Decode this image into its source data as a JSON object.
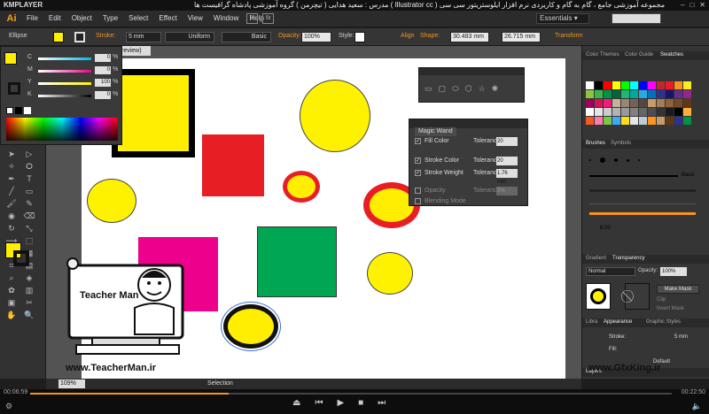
{
  "player": {
    "brand": "KMPLAYER",
    "title": "مجموعه آموزشی جامع ، گام به گام و کاربردی نرم افزار ایلوستریتور سی سی ( Illustrator cc )  مدرس : سعید هدایی ( تیچرمن ) گروه آموزشی پادشاه گرافیست ها",
    "time_elapsed": "00:06:59",
    "time_total": "00:22:50",
    "progress": 0.31
  },
  "app": {
    "logo": "Ai",
    "menus": [
      "File",
      "Edit",
      "Object",
      "Type",
      "Select",
      "Effect",
      "View",
      "Window",
      "Help"
    ],
    "menu_icons": [
      "Br",
      "St"
    ],
    "workspace": "Essentials"
  },
  "control_bar": {
    "object_type": "Ellipse",
    "fill_color": "#ffee00",
    "stroke_label": "Stroke:",
    "stroke_width": "5 mm",
    "profile": "Uniform",
    "brush": "Basic",
    "opacity_label": "Opacity:",
    "opacity_value": "100%",
    "style_label": "Style:",
    "align_label": "Align",
    "shape_label": "Shape:",
    "shape_width": "30.483 mm",
    "shape_height": "26.715 mm",
    "transform_label": "Transform"
  },
  "document": {
    "tab_label": "review)"
  },
  "color_panel": {
    "rows": [
      {
        "label": "C",
        "value": "0",
        "unit": "%",
        "color": "#00b4f0"
      },
      {
        "label": "M",
        "value": "0",
        "unit": "%",
        "color": "#ec008c"
      },
      {
        "label": "Y",
        "value": "100",
        "unit": "%",
        "color": "#fff200"
      },
      {
        "label": "K",
        "value": "0",
        "unit": "%",
        "color": "#000000"
      }
    ]
  },
  "magic_wand": {
    "title": "Magic Wand",
    "rows": [
      {
        "name": "Fill Color",
        "checked": "✓",
        "tolerance_label": "Tolerance:",
        "tolerance": "20",
        "enabled": true
      },
      {
        "name": "Stroke Color",
        "checked": "✓",
        "tolerance_label": "Tolerance:",
        "tolerance": "20",
        "enabled": true
      },
      {
        "name": "Stroke Weight",
        "checked": "✓",
        "tolerance_label": "Tolerance:",
        "tolerance": "1.76 mm",
        "enabled": true
      },
      {
        "name": "Opacity",
        "checked": "",
        "tolerance_label": "Tolerance:",
        "tolerance": "5%",
        "enabled": false
      },
      {
        "name": "Blending Mode",
        "checked": "",
        "tolerance_label": "",
        "tolerance": "",
        "enabled": false
      }
    ]
  },
  "right_panels": {
    "top_tabs": [
      "Color Themes",
      "Color Guide",
      "Swatches"
    ],
    "brush_tabs": [
      "Brushes",
      "Symbols"
    ],
    "brush_basic": "Basic",
    "brush_size": "6.00",
    "transparency_tabs": [
      "Gradient",
      "Transparency"
    ],
    "blend_mode": "Normal",
    "opacity_label": "Opacity:",
    "opacity_value": "100%",
    "make_mask": "Make Mask",
    "clip": "Clip",
    "invert_mask": "Invert Mask",
    "lower_tabs": [
      "Libra",
      "Appearance",
      "Graphic Styles"
    ],
    "stroke_label": "Stroke:",
    "stroke_value": "5 mm",
    "fill_label": "Fill:",
    "default_label": "Default",
    "layers_label": "Layers"
  },
  "status": {
    "zoom": "109%",
    "mode": "Selection"
  },
  "watermark": {
    "left_url": "www.TeacherMan.ir",
    "right_url": "www.GfxKing.ir",
    "logo_name": "Teacher Man"
  }
}
